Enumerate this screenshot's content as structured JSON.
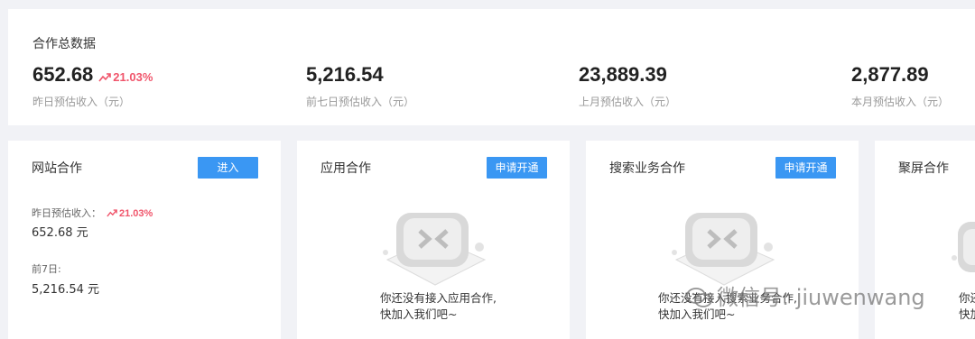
{
  "summary": {
    "title": "合作总数据",
    "metrics": [
      {
        "value": "652.68",
        "trend": "21.03%",
        "label": "昨日预估收入（元）"
      },
      {
        "value": "5,216.54",
        "label": "前七日预估收入（元）"
      },
      {
        "value": "23,889.39",
        "label": "上月预估收入（元）"
      },
      {
        "value": "2,877.89",
        "label": "本月预估收入（元）"
      }
    ]
  },
  "cards": {
    "website": {
      "title": "网站合作",
      "button": "进入",
      "yesterday_label": "昨日预估收入：",
      "yesterday_trend": "21.03%",
      "yesterday_value": "652.68 元",
      "week_label": "前7日:",
      "week_value": "5,216.54 元"
    },
    "app": {
      "title": "应用合作",
      "button": "申请开通",
      "empty_line1": "你还没有接入应用合作,",
      "empty_line2": "快加入我们吧~"
    },
    "search": {
      "title": "搜索业务合作",
      "button": "申请开通",
      "empty_line1": "你还没有接入搜索业务合作,",
      "empty_line2": "快加入我们吧~"
    },
    "screen": {
      "title": "聚屏合作",
      "empty_line1": "你还",
      "empty_line2": "快加"
    }
  },
  "watermark": "微信号: jiuwenwang",
  "colors": {
    "accent": "#3a97f3",
    "trend_up": "#f0556b",
    "background": "#f1f2f6"
  },
  "icons": {
    "trend": "trend-up-icon",
    "empty": "empty-box-icon",
    "watermark": "wechat-icon"
  }
}
